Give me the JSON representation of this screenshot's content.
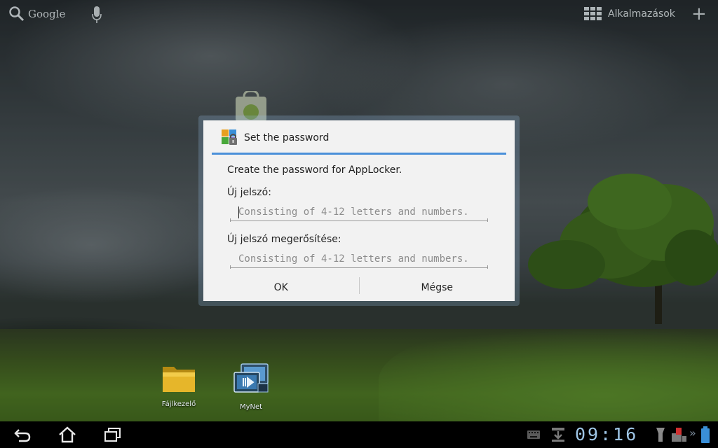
{
  "launcher": {
    "search_label": "Google",
    "apps_label": "Alkalmazások",
    "desktop_icons": [
      {
        "label": "Fájlkezelő",
        "icon": "folder-icon"
      },
      {
        "label": "MyNet",
        "icon": "mynet-icon"
      }
    ]
  },
  "dialog": {
    "title": "Set the password",
    "title_icon": "applocker-lock-icon",
    "prompt": "Create the password for AppLocker.",
    "new_password_label": "Új jelszó:",
    "new_password_placeholder": "Consisting of 4-12 letters and numbers.",
    "new_password_value": "",
    "confirm_label": "Új jelszó megerősítése:",
    "confirm_placeholder": "Consisting of 4-12 letters and numbers.",
    "confirm_value": "",
    "ok_label": "OK",
    "cancel_label": "Mégse",
    "accent_color": "#4a90d9"
  },
  "system_bar": {
    "clock": "09:16",
    "clock_color": "#9fc6e6",
    "icons": [
      "back-icon",
      "home-icon",
      "recent-apps-icon",
      "keyboard-icon",
      "download-icon",
      "flashlight-icon",
      "usb-debug-icon",
      "battery-icon"
    ]
  }
}
